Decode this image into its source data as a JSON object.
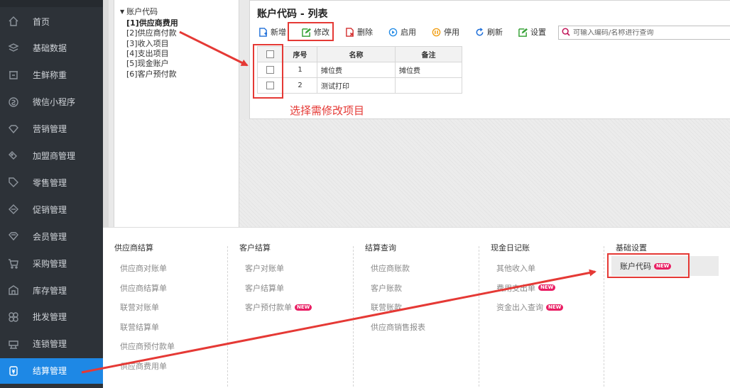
{
  "sidebar": {
    "items": [
      {
        "label": "首页",
        "icon": "home-icon"
      },
      {
        "label": "基础数据",
        "icon": "layers-icon"
      },
      {
        "label": "生鲜称重",
        "icon": "scale-icon"
      },
      {
        "label": "微信小程序",
        "icon": "miniprogram-icon"
      },
      {
        "label": "营销管理",
        "icon": "diamond-icon"
      },
      {
        "label": "加盟商管理",
        "icon": "tag-diamond-icon"
      },
      {
        "label": "零售管理",
        "icon": "tag-icon"
      },
      {
        "label": "促销管理",
        "icon": "promotion-icon"
      },
      {
        "label": "会员管理",
        "icon": "member-icon"
      },
      {
        "label": "采购管理",
        "icon": "cart-icon"
      },
      {
        "label": "库存管理",
        "icon": "warehouse-icon"
      },
      {
        "label": "批发管理",
        "icon": "wholesale-icon"
      },
      {
        "label": "连锁管理",
        "icon": "chain-icon"
      },
      {
        "label": "结算管理",
        "icon": "settlement-icon"
      }
    ],
    "active_index": 13,
    "active_color": "#1e88e5"
  },
  "tree": {
    "root": "账户代码",
    "items": [
      "[1]供应商费用",
      "[2]供应商付款",
      "[3]收入项目",
      "[4]支出项目",
      "[5]现金账户",
      "[6]客户预付款"
    ],
    "selected_index": 0
  },
  "list": {
    "title": "账户代码 - 列表",
    "toolbar": {
      "add": "新增",
      "edit": "修改",
      "delete": "删除",
      "enable": "启用",
      "disable": "停用",
      "refresh": "刷新",
      "settings": "设置"
    },
    "search": {
      "placeholder": "可输入编码/名称进行查询"
    },
    "columns": {
      "seq": "序号",
      "name": "名称",
      "note": "备注"
    },
    "rows": [
      {
        "seq": "1",
        "name": "摊位费",
        "note": "摊位费"
      },
      {
        "seq": "2",
        "name": "测试打印",
        "note": ""
      }
    ]
  },
  "annotation": {
    "text": "选择需修改项目",
    "color": "#e53935"
  },
  "menu": {
    "new_badge": "NEW",
    "columns": [
      {
        "title": "供应商结算",
        "items": [
          "供应商对账单",
          "供应商结算单",
          "联营对账单",
          "联营结算单",
          "供应商预付款单",
          "供应商费用单"
        ]
      },
      {
        "title": "客户结算",
        "items": [
          "客户对账单",
          "客户结算单",
          "客户预付款单"
        ]
      },
      {
        "title": "结算查询",
        "items": [
          "供应商账款",
          "客户账款",
          "联营账款",
          "供应商销售报表"
        ]
      },
      {
        "title": "现金日记账",
        "items": [
          "其他收入单",
          "费用支出单",
          "资金出入查询"
        ]
      },
      {
        "title": "基础设置",
        "items": [
          "账户代码"
        ]
      }
    ]
  }
}
